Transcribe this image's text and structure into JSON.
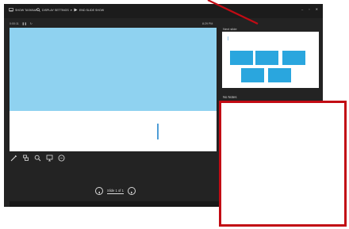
{
  "toolbar": {
    "show_taskbar": "SHOW TASKBAR",
    "display_settings": "DISPLAY SETTINGS",
    "end_show": "END SLIDE SHOW"
  },
  "window_controls": {
    "minimize": "–",
    "restore": "▫",
    "close": "✕"
  },
  "timer": "0:00:11",
  "clock": "8:29 PM",
  "next_slide": {
    "label": "Next slide"
  },
  "notes": {
    "label": "No Notes"
  },
  "navigation": {
    "slide_counter": "Slide 1 of 1"
  },
  "colors": {
    "app_background": "#232323",
    "slide_band": "#8fd2f0",
    "tile_blue": "#2aa6de",
    "annotation_red": "#c20b14"
  },
  "icons": [
    "monitor-icon",
    "search-icon",
    "end-show-icon",
    "pen-icon",
    "slides-grid-icon",
    "zoom-icon",
    "pointer-icon",
    "more-options-icon",
    "prev-icon",
    "next-icon"
  ]
}
